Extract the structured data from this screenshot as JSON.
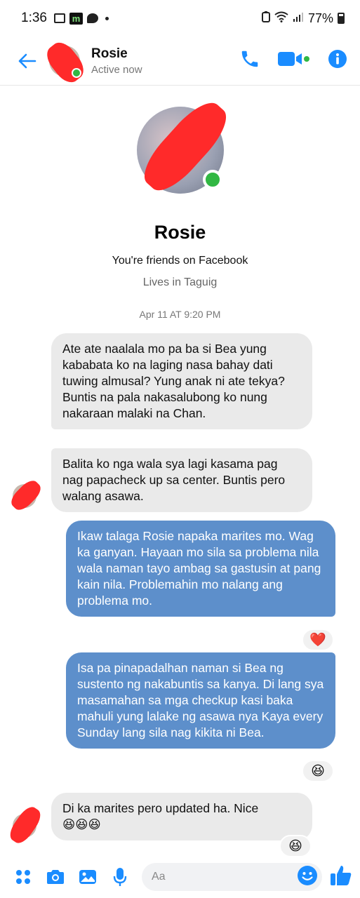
{
  "status_bar": {
    "time": "1:36",
    "battery": "77%"
  },
  "header": {
    "name": "Rosie",
    "status": "Active now"
  },
  "profile": {
    "name": "Rosie",
    "friends_text": "You're friends on Facebook",
    "lives_text": "Lives in Taguig"
  },
  "timestamp": "Apr 11 AT 9:20 PM",
  "messages": [
    {
      "text": "Ate ate naalala mo pa ba si Bea yung kababata ko na laging nasa bahay dati tuwing almusal? Yung anak ni ate tekya? Buntis na pala nakasalubong ko nung nakaraan malaki na Chan."
    },
    {
      "text": "Balita ko nga wala sya lagi kasama pag nag papacheck up sa center. Buntis pero walang asawa."
    },
    {
      "text": "Ikaw talaga Rosie napaka marites mo. Wag ka ganyan. Hayaan mo sila sa problema nila wala naman tayo ambag sa gastusin at pang kain nila. Problemahin mo nalang ang problema mo.",
      "reaction": "❤️"
    },
    {
      "text": "Isa pa pinapadalhan naman si Bea ng sustento ng nakabuntis sa kanya. Di lang sya masamahan sa mga checkup kasi baka mahuli yung lalake ng asawa nya Kaya every Sunday lang sila nag kikita ni Bea.",
      "reaction": "😆"
    },
    {
      "text": "Di ka marites pero updated ha. Nice",
      "emojis": "😆😆😆",
      "reaction": "😆"
    }
  ],
  "composer": {
    "placeholder": "Aa"
  },
  "colors": {
    "accent": "#1a8cff",
    "outgoing_bubble": "#5d8fcb",
    "incoming_bubble": "#eaeaea",
    "online": "#31b743"
  }
}
